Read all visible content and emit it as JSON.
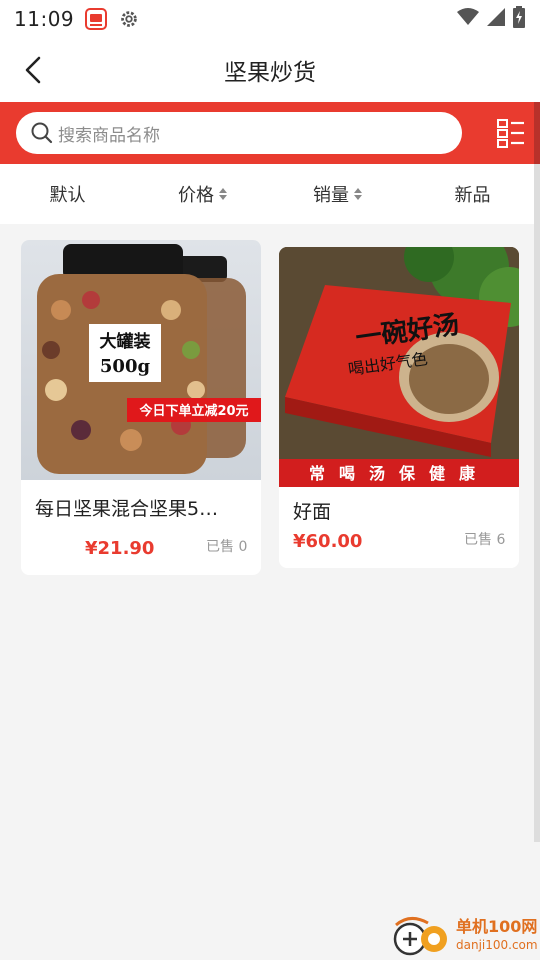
{
  "status_bar": {
    "time": "11:09",
    "icons": [
      "notification-app-icon",
      "settings-gear-icon",
      "wifi-icon",
      "signal-icon",
      "battery-charging-icon"
    ]
  },
  "header": {
    "title": "坚果炒货",
    "back_icon": "chevron-left-icon"
  },
  "search": {
    "placeholder": "搜索商品名称",
    "search_icon": "search-icon",
    "layout_toggle_icon": "list-grid-toggle-icon"
  },
  "sort_tabs": [
    {
      "label": "默认",
      "has_arrows": false
    },
    {
      "label": "价格",
      "has_arrows": true
    },
    {
      "label": "销量",
      "has_arrows": true
    },
    {
      "label": "新品",
      "has_arrows": false
    }
  ],
  "products": [
    {
      "name": "每日坚果混合坚果5…",
      "price": "¥21.90",
      "sold": "已售 0",
      "image_text": {
        "badge_line1": "大罐装",
        "badge_line2": "500g",
        "promo": "今日下单立减20元"
      }
    },
    {
      "name": "好面",
      "price": "¥60.00",
      "sold": "已售 6",
      "image_text": {
        "box_title": "一碗好汤",
        "box_sub": "喝出好气色",
        "banner": "常喝汤保健康"
      }
    }
  ],
  "watermark": {
    "main": "单机100网",
    "sub": "danji100.com"
  },
  "colors": {
    "accent_red": "#e93b2f",
    "price_red": "#e93b2f",
    "watermark_orange": "#e07020"
  }
}
